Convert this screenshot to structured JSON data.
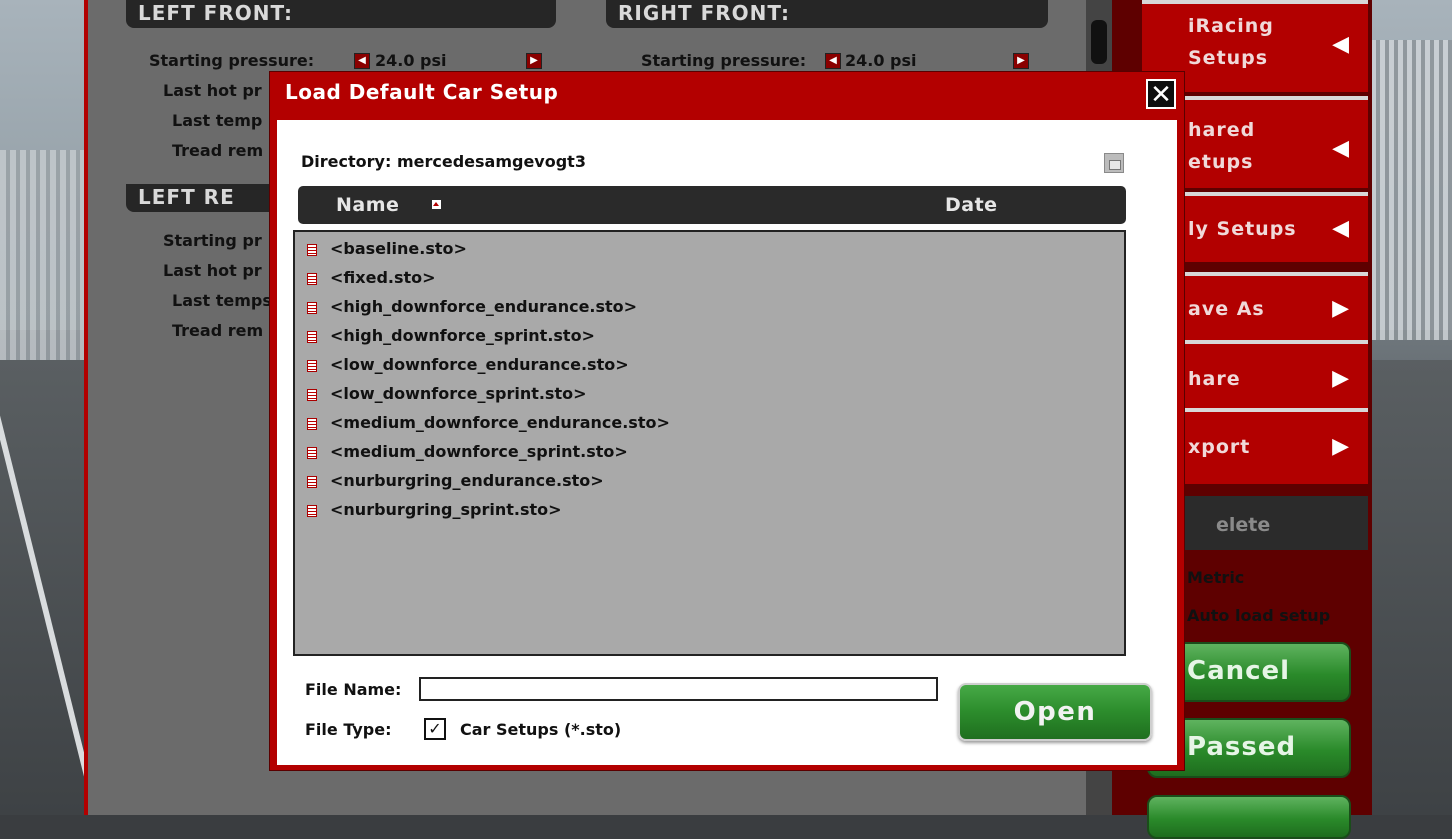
{
  "background": {
    "left_front": {
      "title": "LEFT FRONT:",
      "starting_pressure_label": "Starting pressure:",
      "starting_pressure_value": "24.0 psi",
      "last_hot_label": "Last hot pr",
      "last_temps_label": "Last temp",
      "tread_label": "Tread rem"
    },
    "right_front": {
      "title": "RIGHT FRONT:",
      "starting_pressure_label": "Starting pressure:",
      "starting_pressure_value": "24.0 psi"
    },
    "left_rear": {
      "title": "LEFT RE",
      "starting_pressure_label": "Starting pr",
      "last_hot_label": "Last hot pr",
      "last_temps_label": "Last temps",
      "tread_label": "Tread rem"
    }
  },
  "sidebar": {
    "items": [
      {
        "label": "iRacing\nSetups",
        "icon": "triangle-left-icon"
      },
      {
        "label": "hared\netups",
        "icon": "triangle-left-icon"
      },
      {
        "label": "ly Setups",
        "icon": "triangle-left-icon"
      },
      {
        "label": "ave As",
        "icon": "triangle-right-icon"
      },
      {
        "label": "hare",
        "icon": "triangle-right-icon"
      },
      {
        "label": "xport",
        "icon": "triangle-right-icon"
      }
    ],
    "delete_label": "elete",
    "metric_label": "Metric",
    "auto_load_label": "Auto load setup",
    "cancel_label": "Cancel",
    "passed_label": "Passed"
  },
  "dialog": {
    "title": "Load Default Car Setup",
    "close_glyph": "✕",
    "directory_label": "Directory:",
    "directory_value": "mercedesamgevogt3",
    "columns": {
      "name": "Name",
      "date": "Date"
    },
    "files": [
      "<baseline.sto>",
      "<fixed.sto>",
      "<high_downforce_endurance.sto>",
      "<high_downforce_sprint.sto>",
      "<low_downforce_endurance.sto>",
      "<low_downforce_sprint.sto>",
      "<medium_downforce_endurance.sto>",
      "<medium_downforce_sprint.sto>",
      "<nurburgring_endurance.sto>",
      "<nurburgring_sprint.sto>"
    ],
    "file_name_label": "File Name:",
    "file_name_value": "",
    "file_type_label": "File Type:",
    "file_type_value": "Car Setups (*.sto)",
    "file_type_checked": true,
    "open_label": "Open"
  },
  "colors": {
    "accent_red": "#b30000",
    "open_green": "#2c8c2c",
    "list_bg": "#a9a9a9"
  }
}
